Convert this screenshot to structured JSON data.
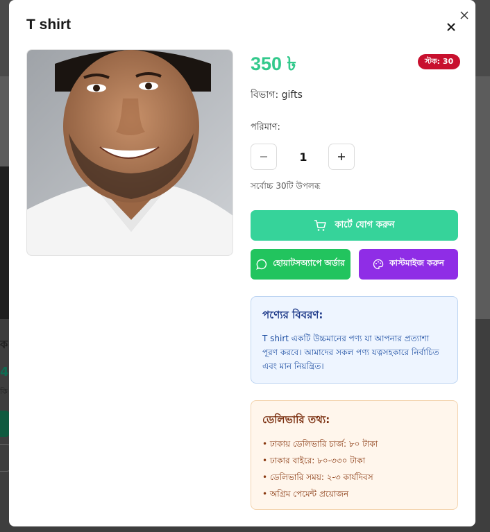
{
  "background": {
    "left_heading": "ক",
    "left_price": "4",
    "left_small": "কি"
  },
  "product": {
    "title": "T shirt",
    "price": "350 ৳",
    "stock_badge": "স্টক: 30",
    "category_label": "বিভাগ: gifts",
    "quantity_label": "পরিমাণ:",
    "quantity_value": "1",
    "max_available": "সর্বোচ্চ 30টি উপলব্ধ"
  },
  "actions": {
    "add_to_cart": "কার্টে যোগ করুন",
    "whatsapp_order": "হোয়াটসঅ্যাপে অর্ডার",
    "customize": "কাস্টমাইজ করুন"
  },
  "description": {
    "heading": "পণ্যের বিবরণ:",
    "text": "T shirt একটি উচ্চমানের পণ্য যা আপনার প্রত্যাশা পূরণ করবে। আমাদের সকল পণ্য যত্নসহকারে নির্বাচিত এবং মান নিয়ন্ত্রিত।"
  },
  "delivery": {
    "heading": "ডেলিভারি তথ্য:",
    "items": [
      "• ঢাকায় ডেলিভারি চার্জ: ৮০ টাকা",
      "• ঢাকার বাইরে: ৮০-৩৩০ টাকা",
      "• ডেলিভারি সময়: ২-৩ কার্যদিবস",
      "• অগ্রিম পেমেন্ট প্রয়োজন"
    ]
  },
  "colors": {
    "price": "#33c98c",
    "stock_badge": "#c8102e",
    "cart_button": "#36d39a",
    "whatsapp_button": "#22c45e",
    "customize_button": "#8f2de6",
    "description_bg": "#eef5ff",
    "delivery_bg": "#fff6ec"
  },
  "icons": {
    "close_top": "close-icon",
    "close_modal": "close-icon",
    "cart": "cart-icon",
    "whatsapp": "chat-bubble-icon",
    "customize": "palette-icon"
  }
}
